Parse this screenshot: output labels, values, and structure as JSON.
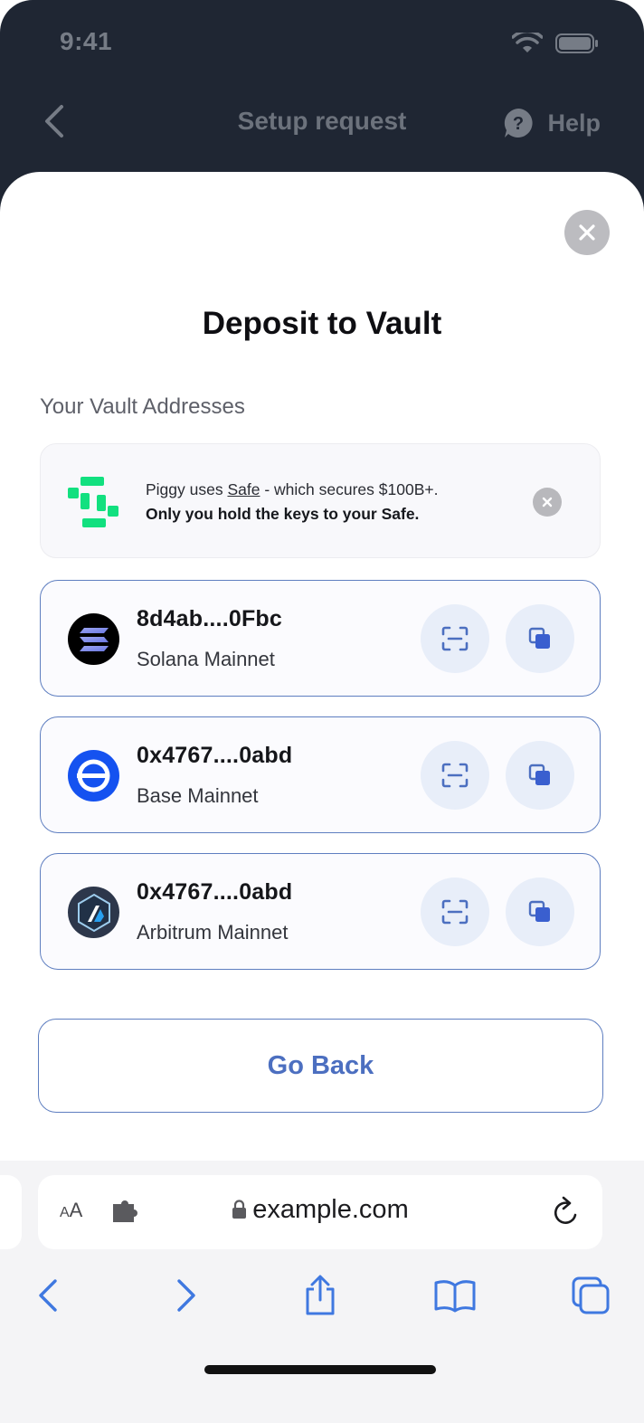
{
  "status_bar": {
    "time": "9:41"
  },
  "nav": {
    "title": "Setup request",
    "help_label": "Help"
  },
  "sheet": {
    "title": "Deposit to Vault",
    "section_label": "Your Vault Addresses",
    "info": {
      "line1_prefix": "Piggy uses ",
      "line1_link": "Safe",
      "line1_suffix": " - which secures $100B+.",
      "line2": "Only you hold the keys to your Safe."
    },
    "addresses": [
      {
        "address": "8d4ab....0Fbc",
        "network": "Solana Mainnet",
        "icon": "solana-logo-icon"
      },
      {
        "address": "0x4767....0abd",
        "network": "Base Mainnet",
        "icon": "base-logo-icon"
      },
      {
        "address": "0x4767....0abd",
        "network": "Arbitrum Mainnet",
        "icon": "arbitrum-logo-icon"
      }
    ],
    "go_back_label": "Go Back"
  },
  "browser": {
    "text_size_label_big": "A",
    "text_size_label_small": "A",
    "url": "example.com"
  },
  "colors": {
    "accent": "#4c6fc0",
    "card_border": "#5e7ec0",
    "safe_green": "#12e07f",
    "header_bg": "#1f2633"
  }
}
